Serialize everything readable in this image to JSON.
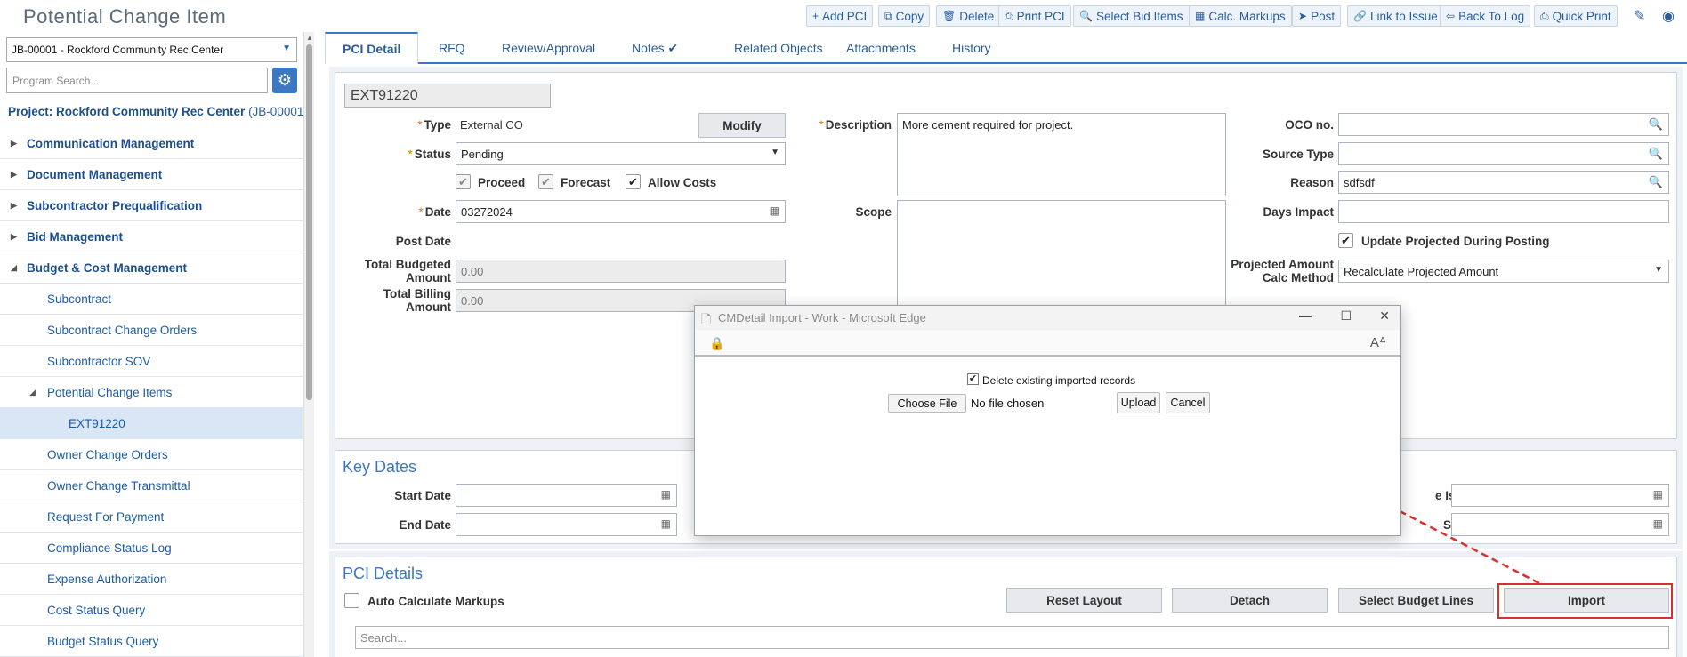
{
  "header": {
    "title": "Potential Change Item",
    "toolbar": [
      {
        "label": "Add PCI",
        "icon": "+"
      },
      {
        "label": "Copy",
        "icon": "⧉"
      },
      {
        "label": "Delete",
        "icon": "🗑"
      },
      {
        "label": "Print PCI",
        "icon": "⎙"
      },
      {
        "label": "Select Bid Items",
        "icon": "🔍"
      },
      {
        "label": "Calc. Markups",
        "icon": "▦"
      },
      {
        "label": "Post",
        "icon": "➤"
      },
      {
        "label": "Link to Issue",
        "icon": "🔗"
      },
      {
        "label": "Back To Log",
        "icon": "⇦"
      },
      {
        "label": "Quick Print",
        "icon": "⎙"
      }
    ]
  },
  "sidebar": {
    "job_select": "JB-00001 - Rockford Community Rec Center",
    "search_placeholder": "Program Search...",
    "project_label": "Project: Rockford Community Rec Center",
    "project_code": "(JB-00001)",
    "items": [
      {
        "label": "Communication Management",
        "level": 0
      },
      {
        "label": "Document Management",
        "level": 0
      },
      {
        "label": "Subcontractor Prequalification",
        "level": 0
      },
      {
        "label": "Bid Management",
        "level": 0
      },
      {
        "label": "Budget & Cost Management",
        "level": 0,
        "expanded": true
      },
      {
        "label": "Subcontract",
        "level": 1
      },
      {
        "label": "Subcontract Change Orders",
        "level": 1
      },
      {
        "label": "Subcontractor SOV",
        "level": 1
      },
      {
        "label": "Potential Change Items",
        "level": 1,
        "expanded": true
      },
      {
        "label": "EXT91220",
        "level": 2,
        "selected": true
      },
      {
        "label": "Owner Change Orders",
        "level": 1
      },
      {
        "label": "Owner Change Transmittal",
        "level": 1
      },
      {
        "label": "Request For Payment",
        "level": 1
      },
      {
        "label": "Compliance Status Log",
        "level": 1
      },
      {
        "label": "Expense Authorization",
        "level": 1
      },
      {
        "label": "Cost Status Query",
        "level": 1
      },
      {
        "label": "Budget Status Query",
        "level": 1
      }
    ]
  },
  "tabs": [
    "PCI Detail",
    "RFQ",
    "Review/Approval",
    "Notes ✔",
    "Related Objects",
    "Attachments",
    "History"
  ],
  "detail": {
    "pci_number": "EXT91220",
    "type_label": "Type",
    "type_value": "External CO",
    "modify_label": "Modify",
    "status_label": "Status",
    "status_value": "Pending",
    "proceed_label": "Proceed",
    "forecast_label": "Forecast",
    "allow_costs_label": "Allow Costs",
    "date_label": "Date",
    "date_value": "03272024",
    "post_date_label": "Post Date",
    "total_budgeted_label": "Total Budgeted Amount",
    "total_budgeted_value": "0.00",
    "total_billing_label": "Total Billing Amount",
    "total_billing_value": "0.00",
    "description_label": "Description",
    "description_value": "More cement required for project.",
    "scope_label": "Scope",
    "oco_label": "OCO no.",
    "source_type_label": "Source Type",
    "reason_label": "Reason",
    "reason_value": "sdfsdf",
    "days_impact_label": "Days Impact",
    "update_projected_label": "Update Projected During Posting",
    "projected_calc_label": "Projected Amount Calc Method",
    "projected_calc_value": "Recalculate Projected Amount"
  },
  "key_dates": {
    "title": "Key Dates",
    "start_date_label": "Start Date",
    "end_date_label": "End Date",
    "issued_label": "e Issued",
    "signed_label": "Signed"
  },
  "pci_details": {
    "title": "PCI Details",
    "auto_calc_label": "Auto Calculate Markups",
    "reset_layout_label": "Reset Layout",
    "detach_label": "Detach",
    "select_budget_label": "Select Budget Lines",
    "import_label": "Import",
    "search_placeholder": "Search..."
  },
  "dialog": {
    "title": "CMDetail Import - Work - Microsoft Edge",
    "delete_existing_label": "Delete existing imported records",
    "choose_file_label": "Choose File",
    "no_file_label": "No file chosen",
    "upload_label": "Upload",
    "cancel_label": "Cancel"
  },
  "colors": {
    "accent": "#3b78c3",
    "highlight": "#d9302c",
    "required": "#e07a00"
  }
}
